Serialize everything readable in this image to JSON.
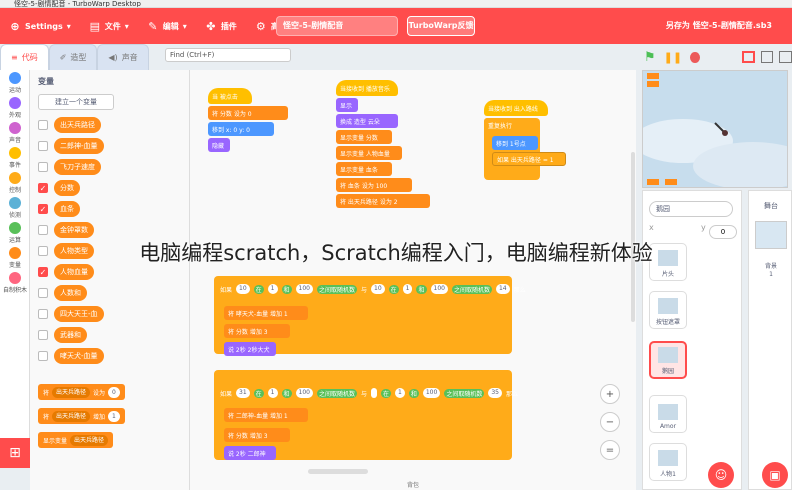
{
  "window": {
    "title": "怪空-5-剧情配音 - TurboWarp Desktop"
  },
  "menu": {
    "settings": "Settings",
    "file": "文件",
    "edit": "编辑",
    "addons": "插件",
    "advanced": "高级",
    "project_title": "怪空-5-剧情配音",
    "feedback": "TurboWarp反馈",
    "save_as": "另存为 怪空-5-剧情配音.sb3"
  },
  "tabs": {
    "code": "代码",
    "costumes": "造型",
    "sounds": "声音"
  },
  "categories": [
    {
      "label": "运动",
      "color": "#4c97ff"
    },
    {
      "label": "外观",
      "color": "#9966ff"
    },
    {
      "label": "声音",
      "color": "#cf63cf"
    },
    {
      "label": "事件",
      "color": "#ffbf00"
    },
    {
      "label": "控制",
      "color": "#ffab19"
    },
    {
      "label": "侦测",
      "color": "#5cb1d6"
    },
    {
      "label": "运算",
      "color": "#59c059"
    },
    {
      "label": "变量",
      "color": "#ff8c1a"
    },
    {
      "label": "自制积木",
      "color": "#ff6680"
    }
  ],
  "palette": {
    "title": "变量",
    "make_variable": "建立一个变量",
    "variables": [
      {
        "name": "出天兵路径",
        "checked": false
      },
      {
        "name": "二郎神-血量",
        "checked": false
      },
      {
        "name": "飞刀子速度",
        "checked": false
      },
      {
        "name": "分数",
        "checked": true
      },
      {
        "name": "血条",
        "checked": true
      },
      {
        "name": "金钟罩数",
        "checked": false
      },
      {
        "name": "人物类型",
        "checked": false
      },
      {
        "name": "人物血量",
        "checked": true
      },
      {
        "name": "人数和",
        "checked": false
      },
      {
        "name": "四大天王-血",
        "checked": false
      },
      {
        "name": "武器和",
        "checked": false
      },
      {
        "name": "哮天犬-血量",
        "checked": false
      }
    ],
    "blocks": [
      {
        "text": "将",
        "dd": "出天兵路径",
        "mid": "设为",
        "val": "0"
      },
      {
        "text": "将",
        "dd": "出天兵路径",
        "mid": "增加",
        "val": "1"
      },
      {
        "text": "显示变量",
        "dd": "出天兵路径",
        "mid": "",
        "val": ""
      }
    ]
  },
  "find": {
    "placeholder": "Find (Ctrl+F)"
  },
  "scripts": {
    "s1": [
      "当 被点击",
      "将 分数 设为 0",
      "移到 x: 0 y: 0",
      "隐藏"
    ],
    "s2": [
      "当接收到 播放音乐",
      "显示",
      "换成 造型 云朵",
      "显示变量 分数",
      "显示变量 人物血量",
      "显示变量 血条",
      "将 血条 设为 100",
      "将 出天兵路径 设为 2"
    ],
    "s3": [
      "当接收到 出入路线",
      "重复执行",
      "移到 1号点",
      "如果 出天兵路径 = 1"
    ],
    "if1": [
      "如果",
      "10",
      "在",
      "1",
      "和",
      "100",
      "之间取随机数",
      "与",
      "10",
      "在",
      "1",
      "和",
      "100",
      "之间取随机数",
      "14",
      "那么"
    ],
    "inner1": [
      "将 哮天犬-血量 增加 1",
      "将 分数 增加 3",
      "说 2秒 2秒大犬"
    ],
    "if2": [
      "如果",
      "31",
      "在",
      "1",
      "和",
      "100",
      "之间取随机数",
      "与",
      "",
      "在",
      "1",
      "和",
      "100",
      "之间取随机数",
      "35",
      "那么"
    ],
    "inner2": [
      "将 二郎神-血量 增加 1",
      "将 分数 增加 3",
      "说 2秒 二郎神"
    ]
  },
  "overlay_text": "电脑编程scratch，Scratch编程入门，电脑编程新体验",
  "sprites": {
    "name_value": "鹅园",
    "x_value": "0",
    "y_value": "0",
    "list": [
      "片头",
      "按钮遮罩",
      "鹅园",
      "Amor",
      "人物1"
    ]
  },
  "stage_panel": {
    "title": "舞台",
    "backdrops_label": "背景",
    "backdrops_count": "1"
  },
  "bottom": {
    "label": "背包"
  }
}
